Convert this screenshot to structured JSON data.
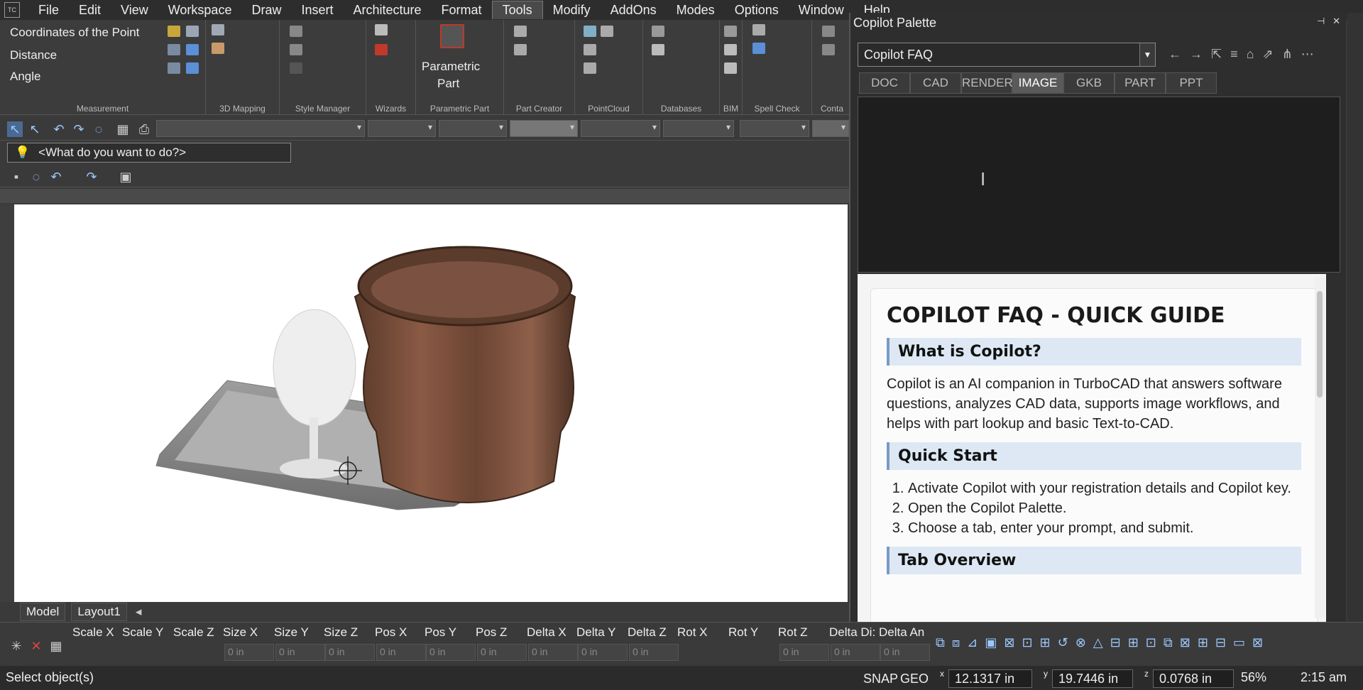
{
  "menu": {
    "items": [
      "File",
      "Edit",
      "View",
      "Workspace",
      "Draw",
      "Insert",
      "Architecture",
      "Format",
      "Tools",
      "Modify",
      "AddOns",
      "Modes",
      "Options",
      "Window",
      "Help"
    ],
    "active": "Tools"
  },
  "ribbon": {
    "measurement": {
      "coordinates": "Coordinates of the Point",
      "distance": "Distance",
      "angle": "Angle",
      "label": "Measurement"
    },
    "mapping_label": "3D Mapping",
    "style_label": "Style Manager",
    "wizards_label": "Wizards",
    "parametric": {
      "button": "Parametric",
      "button2": "Part",
      "label": "Parametric Part"
    },
    "part_creator_label": "Part Creator",
    "pointcloud_label": "PointCloud",
    "databases_label": "Databases",
    "bim_label": "BIM",
    "spell_label": "Spell Check",
    "conta_label": "Conta"
  },
  "toolbar": {
    "what_placeholder": "<What do you want to do?>"
  },
  "layout_tabs": [
    "Model",
    "Layout1"
  ],
  "palette": {
    "title": "Copilot Palette",
    "selector_value": "Copilot FAQ",
    "tabs": [
      "DOC",
      "CAD",
      "RENDER",
      "IMAGE",
      "GKB",
      "PART",
      "PPT"
    ],
    "active_tab": "IMAGE",
    "faq": {
      "title": "COPILOT FAQ - QUICK GUIDE",
      "sec1_title": "What is Copilot?",
      "sec1_body": "Copilot is an AI companion in TurboCAD that answers software questions, analyzes CAD data, supports image workflows, and helps with part lookup and basic Text-to-CAD.",
      "sec2_title": "Quick Start",
      "sec2_steps": [
        "Activate Copilot with your registration details and Copilot key.",
        "Open the Copilot Palette.",
        "Choose a tab, enter your prompt, and submit."
      ],
      "sec3_title": "Tab Overview"
    }
  },
  "inspector": {
    "labels": [
      "Scale X",
      "Scale Y",
      "Scale Z",
      "Size X",
      "Size Y",
      "Size Z",
      "Pos X",
      "Pos Y",
      "Pos Z",
      "Delta X",
      "Delta Y",
      "Delta Z",
      "Rot X",
      "Rot Y",
      "Rot Z",
      "Delta Di:",
      "Delta An"
    ],
    "field_value": "0 in"
  },
  "status": {
    "message": "Select object(s)",
    "snap": "SNAP",
    "geo": "GEO",
    "x": "12.1317 in",
    "y": "19.7446 in",
    "z": "0.0768 in",
    "zoom": "56%",
    "time": "2:15 am"
  }
}
